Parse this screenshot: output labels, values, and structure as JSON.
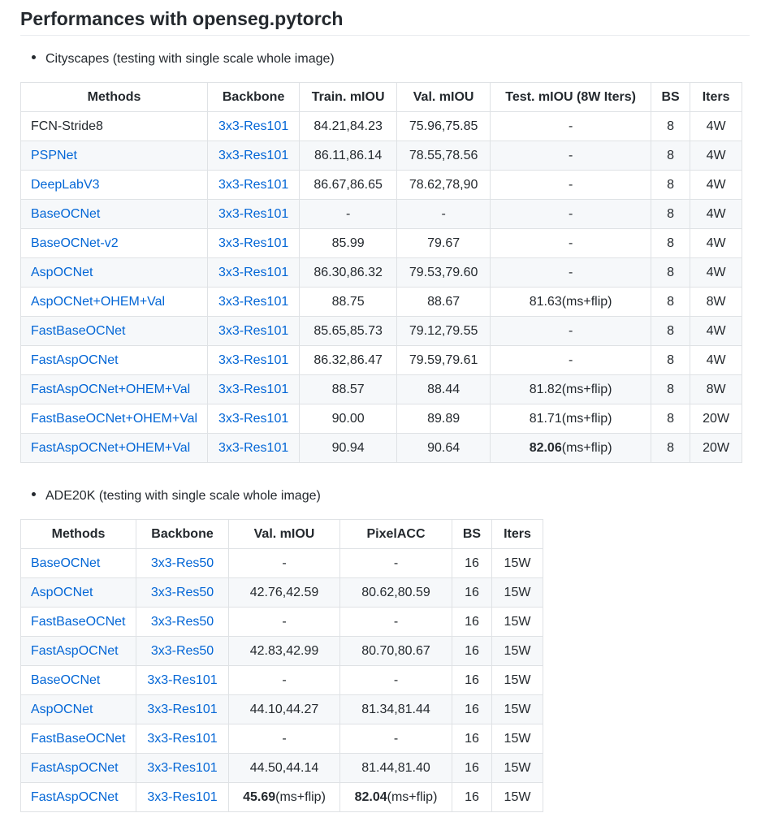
{
  "heading": "Performances with openseg.pytorch",
  "cityscapes": {
    "caption": "Cityscapes (testing with single scale whole image)",
    "headers": [
      "Methods",
      "Backbone",
      "Train. mIOU",
      "Val. mIOU",
      "Test. mIOU (8W Iters)",
      "BS",
      "Iters"
    ],
    "rows": [
      {
        "method": "FCN-Stride8",
        "method_link": false,
        "backbone": "3x3-Res101",
        "train": "84.21,84.23",
        "val": "75.96,75.85",
        "test_bold": "",
        "test": "-",
        "bs": "8",
        "iters": "4W"
      },
      {
        "method": "PSPNet",
        "method_link": true,
        "backbone": "3x3-Res101",
        "train": "86.11,86.14",
        "val": "78.55,78.56",
        "test_bold": "",
        "test": "-",
        "bs": "8",
        "iters": "4W"
      },
      {
        "method": "DeepLabV3",
        "method_link": true,
        "backbone": "3x3-Res101",
        "train": "86.67,86.65",
        "val": "78.62,78,90",
        "test_bold": "",
        "test": "-",
        "bs": "8",
        "iters": "4W"
      },
      {
        "method": "BaseOCNet",
        "method_link": true,
        "backbone": "3x3-Res101",
        "train": "-",
        "val": "-",
        "test_bold": "",
        "test": "-",
        "bs": "8",
        "iters": "4W"
      },
      {
        "method": "BaseOCNet-v2",
        "method_link": true,
        "backbone": "3x3-Res101",
        "train": "85.99",
        "val": "79.67",
        "test_bold": "",
        "test": "-",
        "bs": "8",
        "iters": "4W"
      },
      {
        "method": "AspOCNet",
        "method_link": true,
        "backbone": "3x3-Res101",
        "train": "86.30,86.32",
        "val": "79.53,79.60",
        "test_bold": "",
        "test": "-",
        "bs": "8",
        "iters": "4W"
      },
      {
        "method": "AspOCNet+OHEM+Val",
        "method_link": true,
        "backbone": "3x3-Res101",
        "train": "88.75",
        "val": "88.67",
        "test_bold": "",
        "test": "81.63(ms+flip)",
        "bs": "8",
        "iters": "8W"
      },
      {
        "method": "FastBaseOCNet",
        "method_link": true,
        "backbone": "3x3-Res101",
        "train": "85.65,85.73",
        "val": "79.12,79.55",
        "test_bold": "",
        "test": "-",
        "bs": "8",
        "iters": "4W"
      },
      {
        "method": "FastAspOCNet",
        "method_link": true,
        "backbone": "3x3-Res101",
        "train": "86.32,86.47",
        "val": "79.59,79.61",
        "test_bold": "",
        "test": "-",
        "bs": "8",
        "iters": "4W"
      },
      {
        "method": "FastAspOCNet+OHEM+Val",
        "method_link": true,
        "backbone": "3x3-Res101",
        "train": "88.57",
        "val": "88.44",
        "test_bold": "",
        "test": "81.82(ms+flip)",
        "bs": "8",
        "iters": "8W"
      },
      {
        "method": "FastBaseOCNet+OHEM+Val",
        "method_link": true,
        "backbone": "3x3-Res101",
        "train": "90.00",
        "val": "89.89",
        "test_bold": "",
        "test": "81.71(ms+flip)",
        "bs": "8",
        "iters": "20W"
      },
      {
        "method": "FastAspOCNet+OHEM+Val",
        "method_link": true,
        "backbone": "3x3-Res101",
        "train": "90.94",
        "val": "90.64",
        "test_bold": "82.06",
        "test": "(ms+flip)",
        "bs": "8",
        "iters": "20W"
      }
    ]
  },
  "ade20k": {
    "caption": "ADE20K (testing with single scale whole image)",
    "headers": [
      "Methods",
      "Backbone",
      "Val. mIOU",
      "PixelACC",
      "BS",
      "Iters"
    ],
    "rows": [
      {
        "method": "BaseOCNet",
        "backbone": "3x3-Res50",
        "val_bold": "",
        "val": "-",
        "pix_bold": "",
        "pix": "-",
        "bs": "16",
        "iters": "15W"
      },
      {
        "method": "AspOCNet",
        "backbone": "3x3-Res50",
        "val_bold": "",
        "val": "42.76,42.59",
        "pix_bold": "",
        "pix": "80.62,80.59",
        "bs": "16",
        "iters": "15W"
      },
      {
        "method": "FastBaseOCNet",
        "backbone": "3x3-Res50",
        "val_bold": "",
        "val": "-",
        "pix_bold": "",
        "pix": "-",
        "bs": "16",
        "iters": "15W"
      },
      {
        "method": "FastAspOCNet",
        "backbone": "3x3-Res50",
        "val_bold": "",
        "val": "42.83,42.99",
        "pix_bold": "",
        "pix": "80.70,80.67",
        "bs": "16",
        "iters": "15W"
      },
      {
        "method": "BaseOCNet",
        "backbone": "3x3-Res101",
        "val_bold": "",
        "val": "-",
        "pix_bold": "",
        "pix": "-",
        "bs": "16",
        "iters": "15W"
      },
      {
        "method": "AspOCNet",
        "backbone": "3x3-Res101",
        "val_bold": "",
        "val": "44.10,44.27",
        "pix_bold": "",
        "pix": "81.34,81.44",
        "bs": "16",
        "iters": "15W"
      },
      {
        "method": "FastBaseOCNet",
        "backbone": "3x3-Res101",
        "val_bold": "",
        "val": "-",
        "pix_bold": "",
        "pix": "-",
        "bs": "16",
        "iters": "15W"
      },
      {
        "method": "FastAspOCNet",
        "backbone": "3x3-Res101",
        "val_bold": "",
        "val": "44.50,44.14",
        "pix_bold": "",
        "pix": "81.44,81.40",
        "bs": "16",
        "iters": "15W"
      },
      {
        "method": "FastAspOCNet",
        "backbone": "3x3-Res101",
        "val_bold": "45.69",
        "val": "(ms+flip)",
        "pix_bold": "82.04",
        "pix": "(ms+flip)",
        "bs": "16",
        "iters": "15W"
      }
    ]
  }
}
